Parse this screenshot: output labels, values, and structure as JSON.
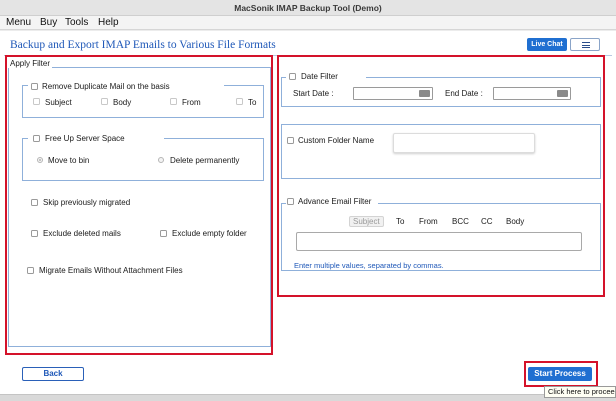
{
  "window": {
    "title": "MacSonik IMAP Backup Tool (Demo)"
  },
  "menu": {
    "items": [
      "Menu",
      "Buy",
      "Tools",
      "Help"
    ]
  },
  "header": {
    "heading": "Backup and Export IMAP Emails to Various File Formats",
    "live_chat": "Live Chat"
  },
  "apply_filter": {
    "legend": "Apply Filter",
    "remove_duplicate": {
      "label": "Remove Duplicate Mail on the basis",
      "options": [
        "Subject",
        "Body",
        "From",
        "To"
      ]
    },
    "free_up": {
      "label": "Free Up Server Space",
      "options": [
        "Move to bin",
        "Delete permanently"
      ],
      "selected": "Move to bin"
    },
    "skip_migrated": "Skip previously migrated",
    "exclude_deleted": "Exclude deleted mails",
    "exclude_empty": "Exclude empty folder",
    "without_attachment": "Migrate Emails Without Attachment Files"
  },
  "date_filter": {
    "label": "Date Filter",
    "start_label": "Start Date :",
    "end_label": "End Date :",
    "start_value": "",
    "end_value": ""
  },
  "custom_folder": {
    "label": "Custom Folder Name",
    "value": ""
  },
  "advance_filter": {
    "label": "Advance Email Filter",
    "tabs": [
      "Subject",
      "To",
      "From",
      "BCC",
      "CC",
      "Body"
    ],
    "selected_tab": "Subject",
    "value": "",
    "hint": "Enter multiple values, separated by commas."
  },
  "buttons": {
    "back": "Back",
    "start": "Start Process"
  },
  "tooltip": "Click here to proceed",
  "colors": {
    "accent": "#1f6fd1",
    "highlight": "#d4122a",
    "heading": "#1f58b8"
  }
}
